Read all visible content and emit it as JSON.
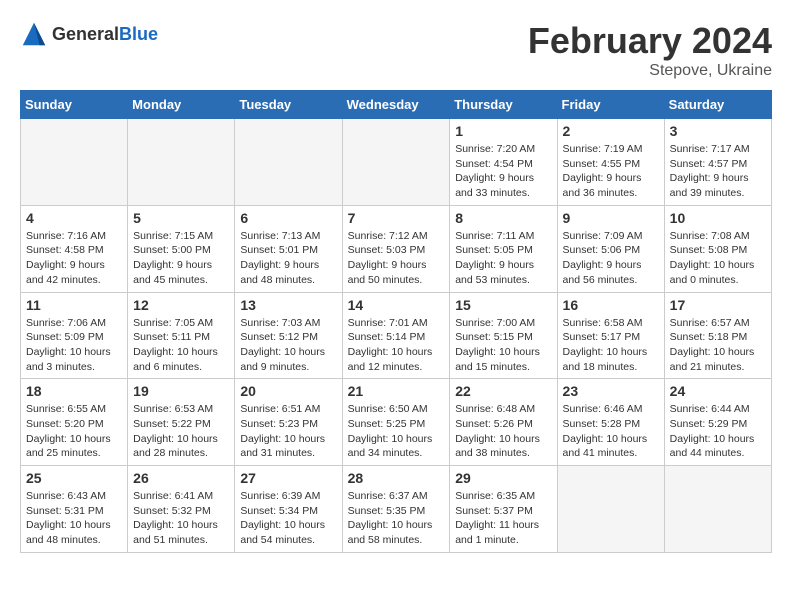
{
  "header": {
    "logo_general": "General",
    "logo_blue": "Blue",
    "title": "February 2024",
    "subtitle": "Stepove, Ukraine"
  },
  "weekdays": [
    "Sunday",
    "Monday",
    "Tuesday",
    "Wednesday",
    "Thursday",
    "Friday",
    "Saturday"
  ],
  "weeks": [
    [
      {
        "day": "",
        "info": ""
      },
      {
        "day": "",
        "info": ""
      },
      {
        "day": "",
        "info": ""
      },
      {
        "day": "",
        "info": ""
      },
      {
        "day": "1",
        "info": "Sunrise: 7:20 AM\nSunset: 4:54 PM\nDaylight: 9 hours\nand 33 minutes."
      },
      {
        "day": "2",
        "info": "Sunrise: 7:19 AM\nSunset: 4:55 PM\nDaylight: 9 hours\nand 36 minutes."
      },
      {
        "day": "3",
        "info": "Sunrise: 7:17 AM\nSunset: 4:57 PM\nDaylight: 9 hours\nand 39 minutes."
      }
    ],
    [
      {
        "day": "4",
        "info": "Sunrise: 7:16 AM\nSunset: 4:58 PM\nDaylight: 9 hours\nand 42 minutes."
      },
      {
        "day": "5",
        "info": "Sunrise: 7:15 AM\nSunset: 5:00 PM\nDaylight: 9 hours\nand 45 minutes."
      },
      {
        "day": "6",
        "info": "Sunrise: 7:13 AM\nSunset: 5:01 PM\nDaylight: 9 hours\nand 48 minutes."
      },
      {
        "day": "7",
        "info": "Sunrise: 7:12 AM\nSunset: 5:03 PM\nDaylight: 9 hours\nand 50 minutes."
      },
      {
        "day": "8",
        "info": "Sunrise: 7:11 AM\nSunset: 5:05 PM\nDaylight: 9 hours\nand 53 minutes."
      },
      {
        "day": "9",
        "info": "Sunrise: 7:09 AM\nSunset: 5:06 PM\nDaylight: 9 hours\nand 56 minutes."
      },
      {
        "day": "10",
        "info": "Sunrise: 7:08 AM\nSunset: 5:08 PM\nDaylight: 10 hours\nand 0 minutes."
      }
    ],
    [
      {
        "day": "11",
        "info": "Sunrise: 7:06 AM\nSunset: 5:09 PM\nDaylight: 10 hours\nand 3 minutes."
      },
      {
        "day": "12",
        "info": "Sunrise: 7:05 AM\nSunset: 5:11 PM\nDaylight: 10 hours\nand 6 minutes."
      },
      {
        "day": "13",
        "info": "Sunrise: 7:03 AM\nSunset: 5:12 PM\nDaylight: 10 hours\nand 9 minutes."
      },
      {
        "day": "14",
        "info": "Sunrise: 7:01 AM\nSunset: 5:14 PM\nDaylight: 10 hours\nand 12 minutes."
      },
      {
        "day": "15",
        "info": "Sunrise: 7:00 AM\nSunset: 5:15 PM\nDaylight: 10 hours\nand 15 minutes."
      },
      {
        "day": "16",
        "info": "Sunrise: 6:58 AM\nSunset: 5:17 PM\nDaylight: 10 hours\nand 18 minutes."
      },
      {
        "day": "17",
        "info": "Sunrise: 6:57 AM\nSunset: 5:18 PM\nDaylight: 10 hours\nand 21 minutes."
      }
    ],
    [
      {
        "day": "18",
        "info": "Sunrise: 6:55 AM\nSunset: 5:20 PM\nDaylight: 10 hours\nand 25 minutes."
      },
      {
        "day": "19",
        "info": "Sunrise: 6:53 AM\nSunset: 5:22 PM\nDaylight: 10 hours\nand 28 minutes."
      },
      {
        "day": "20",
        "info": "Sunrise: 6:51 AM\nSunset: 5:23 PM\nDaylight: 10 hours\nand 31 minutes."
      },
      {
        "day": "21",
        "info": "Sunrise: 6:50 AM\nSunset: 5:25 PM\nDaylight: 10 hours\nand 34 minutes."
      },
      {
        "day": "22",
        "info": "Sunrise: 6:48 AM\nSunset: 5:26 PM\nDaylight: 10 hours\nand 38 minutes."
      },
      {
        "day": "23",
        "info": "Sunrise: 6:46 AM\nSunset: 5:28 PM\nDaylight: 10 hours\nand 41 minutes."
      },
      {
        "day": "24",
        "info": "Sunrise: 6:44 AM\nSunset: 5:29 PM\nDaylight: 10 hours\nand 44 minutes."
      }
    ],
    [
      {
        "day": "25",
        "info": "Sunrise: 6:43 AM\nSunset: 5:31 PM\nDaylight: 10 hours\nand 48 minutes."
      },
      {
        "day": "26",
        "info": "Sunrise: 6:41 AM\nSunset: 5:32 PM\nDaylight: 10 hours\nand 51 minutes."
      },
      {
        "day": "27",
        "info": "Sunrise: 6:39 AM\nSunset: 5:34 PM\nDaylight: 10 hours\nand 54 minutes."
      },
      {
        "day": "28",
        "info": "Sunrise: 6:37 AM\nSunset: 5:35 PM\nDaylight: 10 hours\nand 58 minutes."
      },
      {
        "day": "29",
        "info": "Sunrise: 6:35 AM\nSunset: 5:37 PM\nDaylight: 11 hours\nand 1 minute."
      },
      {
        "day": "",
        "info": ""
      },
      {
        "day": "",
        "info": ""
      }
    ]
  ]
}
